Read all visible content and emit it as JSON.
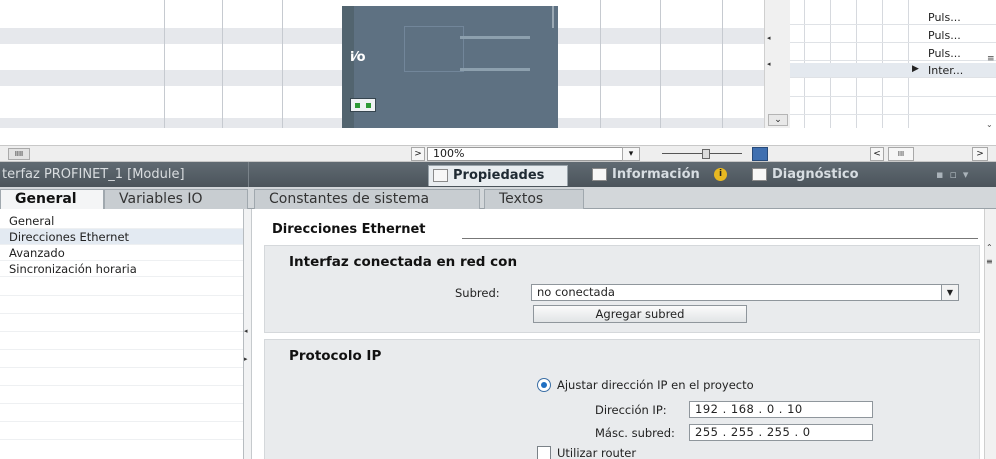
{
  "overview": {
    "rows": [
      "Puls...",
      "Puls...",
      "Puls...",
      "Inter..."
    ]
  },
  "toolbar": {
    "zoom_value": "100%",
    "scroll_left_glyph": "IIII",
    "scroll_mid_glyph": "III"
  },
  "inspector": {
    "title": "terfaz PROFINET_1 [Module]",
    "tabs": {
      "properties": "Propiedades",
      "info": "Información",
      "diagnostics": "Diagnóstico"
    },
    "info_badge": "i"
  },
  "subtabs": [
    "General",
    "Variables IO",
    "Constantes de sistema",
    "Textos"
  ],
  "nav": {
    "items": [
      "General",
      "Direcciones Ethernet",
      "Avanzado",
      "Sincronización horaria"
    ],
    "selected_index": 1
  },
  "content": {
    "section_title": "Direcciones Ethernet",
    "network_panel": {
      "heading": "Interfaz conectada en red con",
      "subnet_label": "Subred:",
      "subnet_value": "no conectada",
      "add_subnet_button": "Agregar subred"
    },
    "ip_panel": {
      "heading": "Protocolo IP",
      "radio_label": "Ajustar dirección IP en el proyecto",
      "ip_label": "Dirección IP:",
      "ip_value": "192 . 168 . 0 . 10",
      "mask_label": "Másc. subred:",
      "mask_value": "255 . 255 . 255 . 0",
      "router_label": "Utilizar router"
    }
  },
  "colors": {
    "titlebar": "#4b545b",
    "rack": "#5e7182",
    "selection": "#e3eaf2",
    "panel": "#e9ebed",
    "radio_accent": "#1f6fc2"
  }
}
